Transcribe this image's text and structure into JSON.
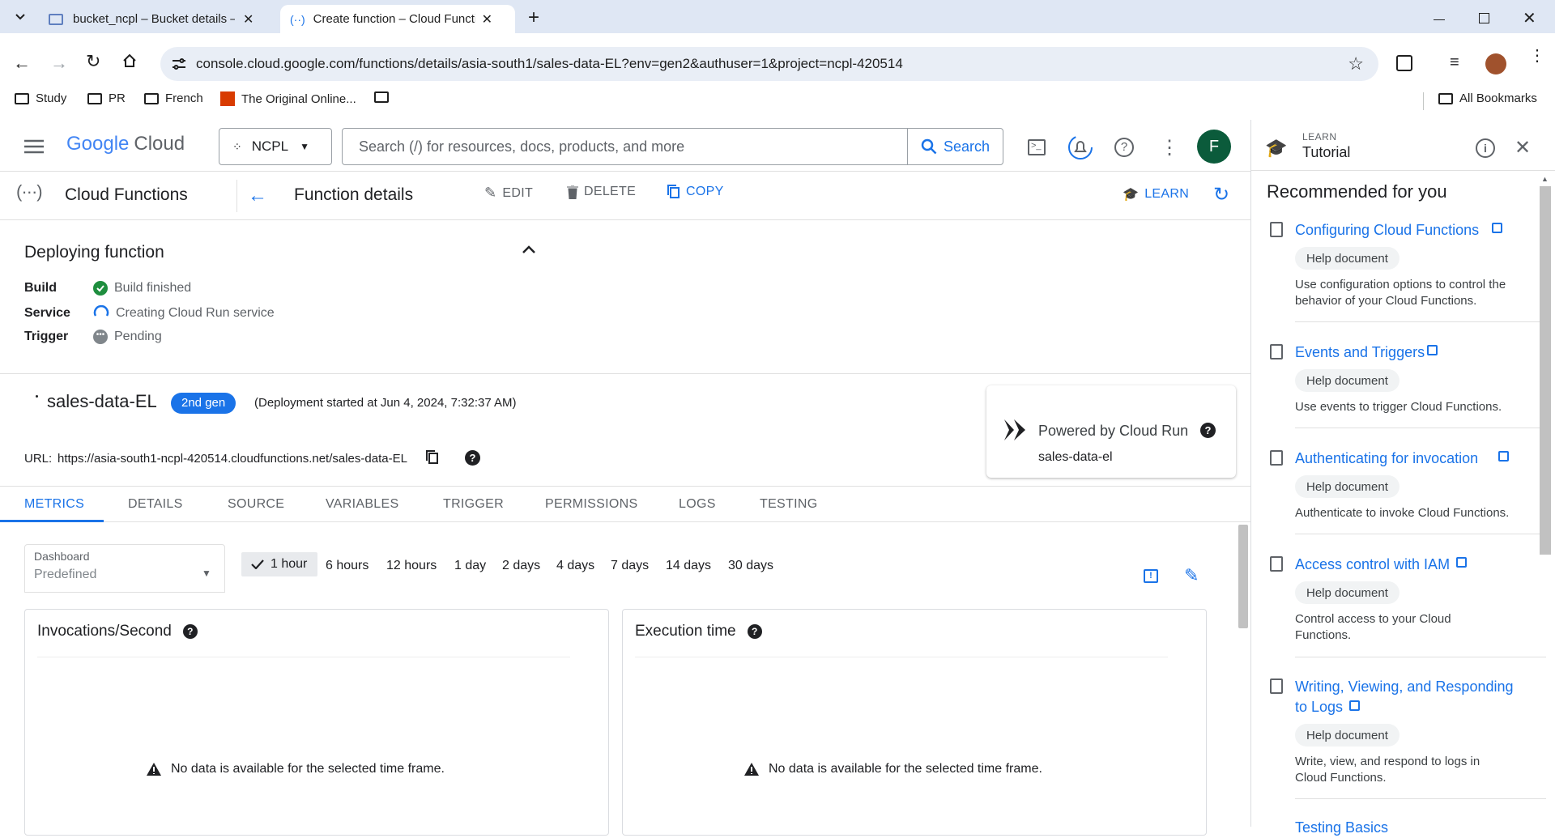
{
  "browser": {
    "tabs": [
      {
        "title": "bucket_ncpl – Bucket details – C"
      },
      {
        "title": "Create function – Cloud Functio"
      }
    ],
    "url": "console.cloud.google.com/functions/details/asia-south1/sales-data-EL?env=gen2&authuser=1&project=ncpl-420514",
    "bookmarks": [
      "Study",
      "PR",
      "French",
      "The Original Online...",
      ""
    ],
    "all_bookmarks": "All Bookmarks"
  },
  "header": {
    "logo_google": "Google",
    "logo_cloud": "Cloud",
    "project": "NCPL",
    "search_placeholder": "Search (/) for resources, docs, products, and more",
    "search_button": "Search",
    "avatar_letter": "F"
  },
  "subheader": {
    "product": "Cloud Functions",
    "page_title": "Function details",
    "edit": "EDIT",
    "delete": "DELETE",
    "copy": "COPY",
    "learn": "LEARN"
  },
  "deploy": {
    "title": "Deploying function",
    "rows": [
      {
        "label": "Build",
        "value": "Build finished"
      },
      {
        "label": "Service",
        "value": "Creating Cloud Run service"
      },
      {
        "label": "Trigger",
        "value": "Pending"
      }
    ]
  },
  "function": {
    "name": "sales-data-EL",
    "gen": "2nd gen",
    "deployment_note": "(Deployment started at Jun 4, 2024, 7:32:37 AM)",
    "url_label": "URL:",
    "url": "https://asia-south1-ncpl-420514.cloudfunctions.net/sales-data-EL",
    "powered_by": "Powered by Cloud Run",
    "service_name": "sales-data-el"
  },
  "tabs": [
    "METRICS",
    "DETAILS",
    "SOURCE",
    "VARIABLES",
    "TRIGGER",
    "PERMISSIONS",
    "LOGS",
    "TESTING"
  ],
  "metrics": {
    "dashboard_label": "Dashboard",
    "dashboard_value": "Predefined",
    "time_ranges": [
      "1 hour",
      "6 hours",
      "12 hours",
      "1 day",
      "2 days",
      "4 days",
      "7 days",
      "14 days",
      "30 days"
    ],
    "selected_range": "1 hour",
    "cards": [
      {
        "title": "Invocations/Second",
        "empty": "No data is available for the selected time frame."
      },
      {
        "title": "Execution time",
        "empty": "No data is available for the selected time frame."
      }
    ]
  },
  "panel": {
    "eyebrow": "LEARN",
    "title": "Tutorial",
    "heading": "Recommended for you",
    "items": [
      {
        "title": "Configuring Cloud Functions",
        "badge": "Help document",
        "desc": "Use configuration options to control the behavior of your Cloud Functions."
      },
      {
        "title": "Events and Triggers",
        "badge": "Help document",
        "desc": "Use events to trigger Cloud Functions."
      },
      {
        "title": "Authenticating for invocation",
        "badge": "Help document",
        "desc": "Authenticate to invoke Cloud Functions."
      },
      {
        "title": "Access control with IAM",
        "badge": "Help document",
        "desc": "Control access to your Cloud Functions."
      },
      {
        "title_line1": "Writing, Viewing, and Responding",
        "title_line2": "to Logs",
        "badge": "Help document",
        "desc": "Write, view, and respond to logs in Cloud Functions."
      },
      {
        "title": "Testing Basics"
      }
    ]
  },
  "colors": {
    "accent": "#1a73e8",
    "success": "#1e8e3e",
    "gen_badge": "#1a73e8"
  }
}
